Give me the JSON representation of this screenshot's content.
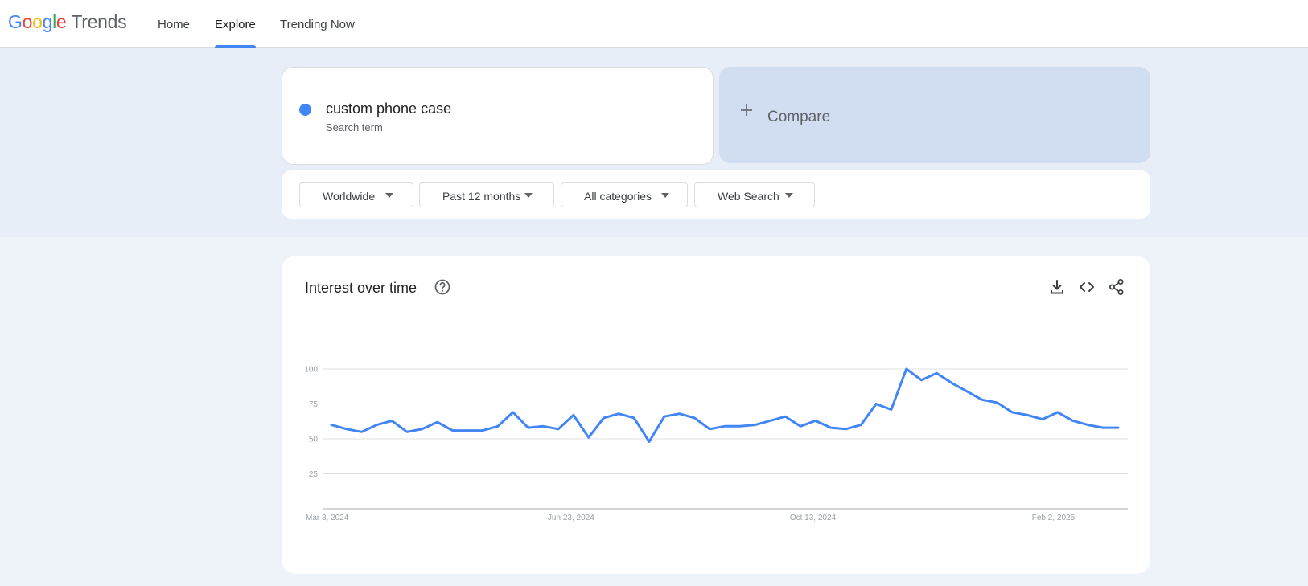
{
  "header": {
    "logo_google": "Google",
    "logo_trends": "Trends",
    "nav": [
      {
        "label": "Home"
      },
      {
        "label": "Explore"
      },
      {
        "label": "Trending Now"
      }
    ],
    "active_tab": "Explore"
  },
  "search_term": {
    "name": "custom phone case",
    "sublabel": "Search term",
    "color": "#4285f4"
  },
  "compare": {
    "label": "Compare",
    "icon": "plus-icon"
  },
  "filters": [
    {
      "label": "Worldwide"
    },
    {
      "label": "Past 12 months"
    },
    {
      "label": "All categories"
    },
    {
      "label": "Web Search"
    }
  ],
  "chart_card": {
    "title": "Interest over time",
    "icons": [
      "help-icon",
      "download-icon",
      "embed-code-icon",
      "share-icon"
    ]
  },
  "chart_data": {
    "type": "line",
    "title": "Interest over time",
    "xlabel": "",
    "ylabel": "",
    "ylim": [
      0,
      100
    ],
    "y_ticks": [
      25,
      50,
      75,
      100
    ],
    "x_tick_labels": [
      "Mar 3, 2024",
      "Jun 23, 2024",
      "Oct 13, 2024",
      "Feb 2, 2025"
    ],
    "x_tick_indices": [
      0,
      16,
      32,
      48
    ],
    "grid": true,
    "legend": "none",
    "series": [
      {
        "color": "#4285f4",
        "values": [
          60,
          57,
          55,
          60,
          63,
          55,
          57,
          62,
          56,
          56,
          56,
          59,
          69,
          58,
          59,
          57,
          67,
          51,
          65,
          68,
          65,
          48,
          66,
          68,
          65,
          57,
          59,
          59,
          60,
          63,
          66,
          59,
          63,
          58,
          57,
          60,
          75,
          71,
          100,
          92,
          97,
          90,
          84,
          78,
          76,
          69,
          67,
          64,
          69,
          63,
          60,
          58,
          58
        ]
      }
    ]
  }
}
